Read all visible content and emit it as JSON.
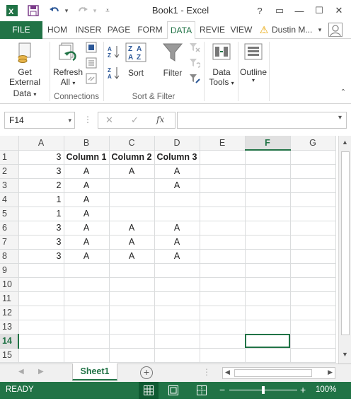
{
  "window": {
    "title": "Book1 - Excel",
    "controls": [
      "?",
      "▭",
      "—",
      "☐",
      "✕"
    ]
  },
  "quick_access": {
    "excel_icon": "excel-logo-icon",
    "save_icon": "save-icon",
    "undo_icon": "undo-icon",
    "redo_icon": "redo-icon",
    "customize_icon": "customize-qat-icon"
  },
  "tabs": [
    {
      "label": "FILE"
    },
    {
      "label": "HOM"
    },
    {
      "label": "INSER"
    },
    {
      "label": "PAGE"
    },
    {
      "label": "FORM"
    },
    {
      "label": "DATA"
    },
    {
      "label": "REVIE"
    },
    {
      "label": "VIEW"
    }
  ],
  "user": {
    "name": "Dustin M..."
  },
  "ribbon": {
    "get_external_data": {
      "line1": "Get External",
      "line2": "Data"
    },
    "refresh": {
      "line1": "Refresh",
      "line2": "All"
    },
    "sort": {
      "label": "Sort"
    },
    "filter": {
      "label": "Filter"
    },
    "data_tools": {
      "line1": "Data",
      "line2": "Tools"
    },
    "outline": {
      "label": "Outline"
    },
    "groups": {
      "connections": "Connections",
      "sort_filter": "Sort & Filter"
    }
  },
  "formula_bar": {
    "name_box": "F14",
    "fx": "fx",
    "value": ""
  },
  "sheet": {
    "columns": [
      "A",
      "B",
      "C",
      "D",
      "E",
      "F",
      "G"
    ],
    "selected_column": "F",
    "selected_row": 14,
    "rows": [
      {
        "n": "1",
        "cells": [
          "3",
          "Column 1",
          "Column 2",
          "Column 3",
          "",
          "",
          ""
        ]
      },
      {
        "n": "2",
        "cells": [
          "3",
          "A",
          "A",
          "A",
          "",
          "",
          ""
        ]
      },
      {
        "n": "3",
        "cells": [
          "2",
          "A",
          "",
          "A",
          "",
          "",
          ""
        ]
      },
      {
        "n": "4",
        "cells": [
          "1",
          "A",
          "",
          "",
          "",
          "",
          ""
        ]
      },
      {
        "n": "5",
        "cells": [
          "1",
          "A",
          "",
          "",
          "",
          "",
          ""
        ]
      },
      {
        "n": "6",
        "cells": [
          "3",
          "A",
          "A",
          "A",
          "",
          "",
          ""
        ]
      },
      {
        "n": "7",
        "cells": [
          "3",
          "A",
          "A",
          "A",
          "",
          "",
          ""
        ]
      },
      {
        "n": "8",
        "cells": [
          "3",
          "A",
          "A",
          "A",
          "",
          "",
          ""
        ]
      },
      {
        "n": "9",
        "cells": [
          "",
          "",
          "",
          "",
          "",
          "",
          ""
        ]
      },
      {
        "n": "10",
        "cells": [
          "",
          "",
          "",
          "",
          "",
          "",
          ""
        ]
      },
      {
        "n": "11",
        "cells": [
          "",
          "",
          "",
          "",
          "",
          "",
          ""
        ]
      },
      {
        "n": "12",
        "cells": [
          "",
          "",
          "",
          "",
          "",
          "",
          ""
        ]
      },
      {
        "n": "13",
        "cells": [
          "",
          "",
          "",
          "",
          "",
          "",
          ""
        ]
      },
      {
        "n": "14",
        "cells": [
          "",
          "",
          "",
          "",
          "",
          "",
          ""
        ]
      },
      {
        "n": "15",
        "cells": [
          "",
          "",
          "",
          "",
          "",
          "",
          ""
        ]
      }
    ]
  },
  "sheet_tabs": {
    "active": "Sheet1"
  },
  "status": {
    "left": "READY",
    "zoom": "100%",
    "zoom_level": 0.5
  },
  "colors": {
    "accent": "#217346",
    "grid": "#dadcdd"
  }
}
